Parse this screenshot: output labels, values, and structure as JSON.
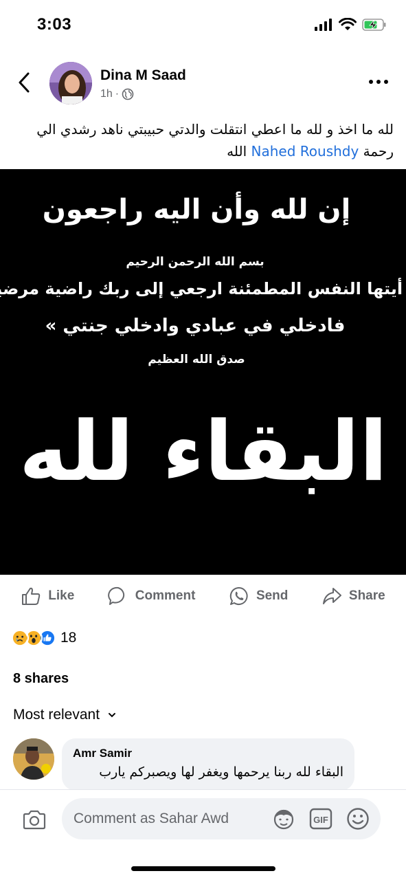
{
  "status": {
    "time": "3:03"
  },
  "post": {
    "author": "Dina M Saad",
    "time": "1h",
    "separator": "·",
    "text_line1": "لله ما اخذ و لله ما اعطي انتقلت والدتي حبيبتي ناهد رشدي الي",
    "text_line2_before": "رحمة ",
    "mention": "Nahed Roushdy",
    "text_line2_after": " الله"
  },
  "image_text": {
    "line1": "إن لله وأن اليه راجعون",
    "line2": "بسم الله الرحمن الرحيم",
    "line3": "« يا أيتها النفس المطمئنة ارجعي إلى ربك راضية مرضية",
    "line4": "فادخلي في عبادي وادخلي جنتي »",
    "line5": "صدق الله العظيم",
    "big": "البقاء لله"
  },
  "actions": {
    "like": "Like",
    "comment": "Comment",
    "send": "Send",
    "share": "Share"
  },
  "reactions": {
    "count": "18",
    "types": [
      "sad",
      "wow",
      "like"
    ]
  },
  "shares": "8 shares",
  "sort": {
    "label": "Most relevant"
  },
  "comment": {
    "author": "Amr Samir",
    "text": "البقاء لله ربنا يرحمها ويغفر لها ويصبركم يارب"
  },
  "composer": {
    "placeholder": "Comment as Sahar Awd"
  },
  "colors": {
    "link": "#216fdb",
    "secondary_text": "#65676b",
    "like_blue": "#1877f2",
    "emoji_yellow": "#f7b125"
  }
}
